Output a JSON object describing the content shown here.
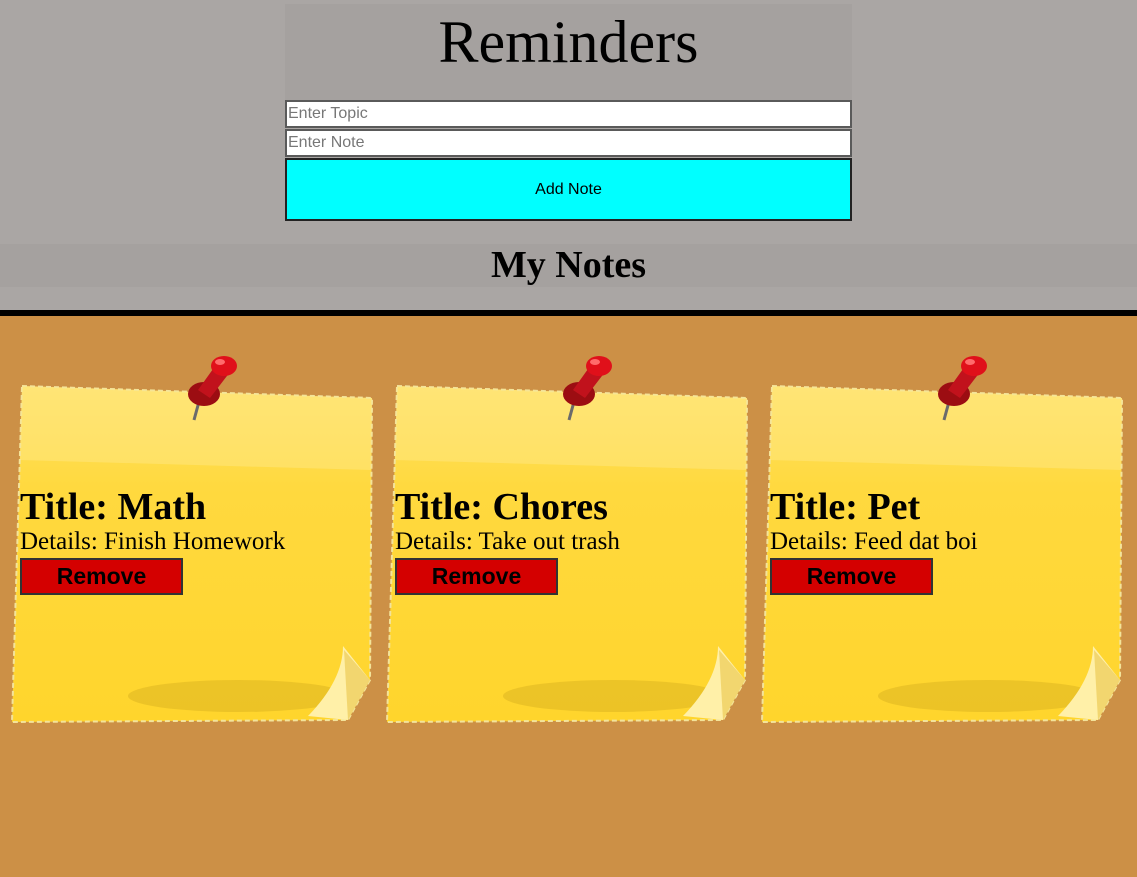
{
  "app": {
    "title": "Reminders"
  },
  "form": {
    "topic_placeholder": "Enter Topic",
    "topic_value": "",
    "note_placeholder": "Enter Note",
    "note_value": "",
    "add_button_label": "Add Note"
  },
  "notes_section": {
    "heading": "My Notes"
  },
  "notes": [
    {
      "title": "Title: Math",
      "details": "Details: Finish Homework",
      "remove_label": "Remove"
    },
    {
      "title": "Title: Chores",
      "details": "Details: Take out trash",
      "remove_label": "Remove"
    },
    {
      "title": "Title: Pet",
      "details": "Details: Feed dat boi",
      "remove_label": "Remove"
    }
  ],
  "colors": {
    "header_bg": "#aaa6a4",
    "board_bg": "#cc9046",
    "add_button": "#00ffff",
    "remove_button": "#d40000",
    "sticky_note": "#ffd633",
    "pin": "#e0101a"
  },
  "icons": {
    "note_pin": "pushpin-icon"
  }
}
